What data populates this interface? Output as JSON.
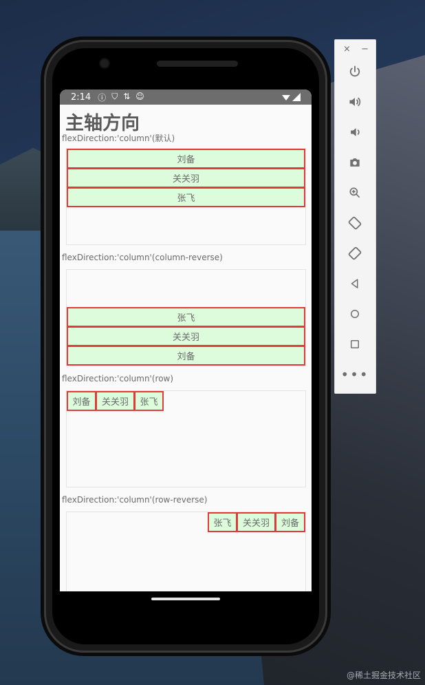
{
  "status_bar": {
    "time": "2:14",
    "icons": [
      "info-icon",
      "shield-icon",
      "sync-icon",
      "face-icon"
    ]
  },
  "screen": {
    "heading": "主轴方向",
    "sections": [
      {
        "label": "flexDirection:'column'(默认)",
        "items": [
          "刘备",
          "关关羽",
          "张飞"
        ]
      },
      {
        "label": "flexDirection:'column'(column-reverse)",
        "items": [
          "张飞",
          "关关羽",
          "刘备"
        ]
      },
      {
        "label": "flexDirection:'column'(row)",
        "items": [
          "刘备",
          "关关羽",
          "张飞"
        ]
      },
      {
        "label": "flexDirection:'column'(row-reverse)",
        "items": [
          "张飞",
          "关关羽",
          "刘备"
        ]
      }
    ]
  },
  "toolbar": {
    "close_label": "×",
    "minimize_label": "−",
    "buttons": [
      "power-icon",
      "volume-up-icon",
      "volume-down-icon",
      "camera-icon",
      "zoom-icon",
      "rotate-left-icon",
      "rotate-right-icon",
      "back-icon",
      "home-icon",
      "overview-icon",
      "more-icon"
    ]
  },
  "watermark": "@稀土掘金技术社区",
  "colors": {
    "item_bg": "#dcfcdc",
    "item_border": "#e23a3a",
    "status_bar": "#6d6d6d"
  }
}
